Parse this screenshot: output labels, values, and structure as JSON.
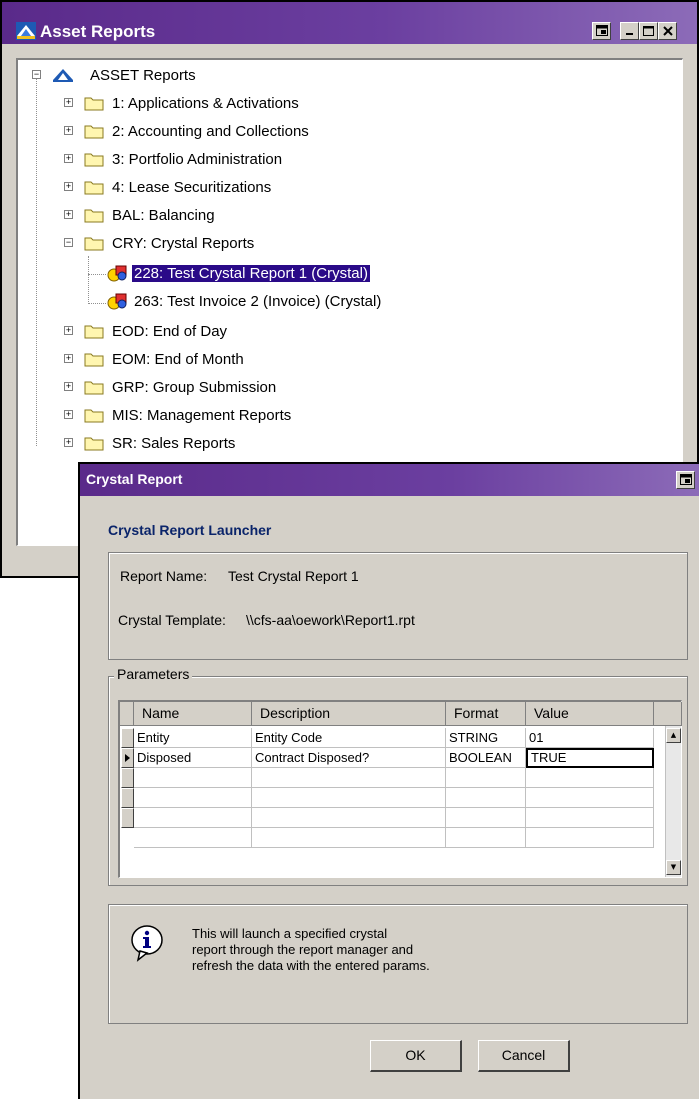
{
  "asset_window": {
    "title": "Asset Reports",
    "tree": {
      "root_label": "ASSET Reports",
      "folders": [
        {
          "label": "1: Applications & Activations",
          "expanded": false
        },
        {
          "label": "2: Accounting and Collections",
          "expanded": false
        },
        {
          "label": "3: Portfolio Administration",
          "expanded": false
        },
        {
          "label": "4: Lease Securitizations",
          "expanded": false
        },
        {
          "label": "BAL: Balancing",
          "expanded": false
        },
        {
          "label": "CRY: Crystal Reports",
          "expanded": true,
          "children": [
            {
              "label": "228: Test Crystal Report 1 (Crystal)",
              "selected": true
            },
            {
              "label": "263: Test Invoice 2 (Invoice) (Crystal)",
              "selected": false
            }
          ]
        },
        {
          "label": "EOD: End of Day",
          "expanded": false
        },
        {
          "label": "EOM: End of Month",
          "expanded": false
        },
        {
          "label": "GRP: Group Submission",
          "expanded": false
        },
        {
          "label": "MIS: Management Reports",
          "expanded": false
        },
        {
          "label": "SR: Sales Reports",
          "expanded": false
        }
      ]
    }
  },
  "crystal_dialog": {
    "title": "Crystal Report",
    "heading": "Crystal Report Launcher",
    "report_name_label": "Report Name:",
    "report_name_value": "Test Crystal Report 1",
    "template_label": "Crystal Template:",
    "template_value": "\\\\cfs-aa\\oework\\Report1.rpt",
    "parameters_label": "Parameters",
    "columns": [
      "Name",
      "Description",
      "Format",
      "Value"
    ],
    "rows": [
      [
        "Entity",
        "Entity Code",
        "STRING",
        "01"
      ],
      [
        "Disposed",
        "Contract Disposed?",
        "BOOLEAN",
        "TRUE"
      ]
    ],
    "info_lines": [
      "This will launch a specified crystal",
      "report through the report manager and",
      "refresh the data with the entered params."
    ],
    "ok_label": "OK",
    "cancel_label": "Cancel"
  },
  "icons": {
    "app": "asset-logo-icon",
    "folder": "folder-icon",
    "report": "crystal-report-icon",
    "info": "info-icon"
  },
  "colors": {
    "titlebar": "#6b3fa0",
    "selection": "#2a0a88",
    "dialog_heading": "#0a246a",
    "face": "#d4d0c8"
  }
}
